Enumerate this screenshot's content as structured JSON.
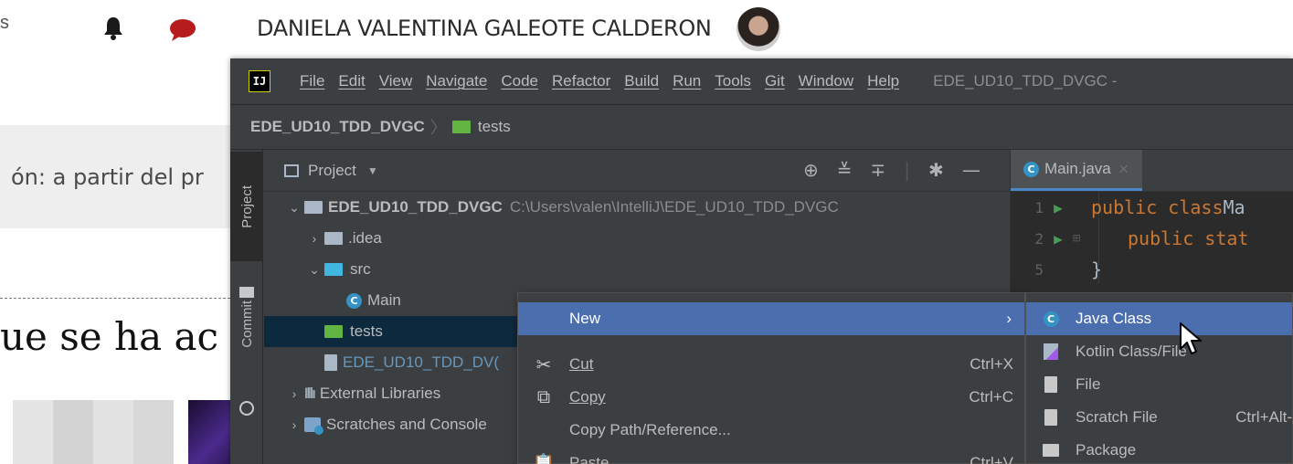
{
  "web": {
    "left_fragment": "s",
    "username": "DANIELA VALENTINA GALEOTE CALDERON",
    "gray_text": "ón: a partir del pr",
    "heading_fragment": "ue se ha ac"
  },
  "ide": {
    "menu": [
      "File",
      "Edit",
      "View",
      "Navigate",
      "Code",
      "Refactor",
      "Build",
      "Run",
      "Tools",
      "Git",
      "Window",
      "Help"
    ],
    "window_title": "EDE_UD10_TDD_DVGC -",
    "breadcrumb": {
      "root": "EDE_UD10_TDD_DVGC",
      "folder": "tests"
    },
    "side_tabs": {
      "project": "Project",
      "commit": "Commit"
    },
    "panel_title": "Project",
    "tree": {
      "root_name": "EDE_UD10_TDD_DVGC",
      "root_path": "C:\\Users\\valen\\IntelliJ\\EDE_UD10_TDD_DVGC",
      "idea": ".idea",
      "src": "src",
      "main": "Main",
      "tests": "tests",
      "iml": "EDE_UD10_TDD_DV(",
      "external_libraries": "External Libraries",
      "scratches": "Scratches and Console"
    },
    "editor": {
      "tab": "Main.java",
      "lines": [
        {
          "num": "1",
          "code_kw": "public class",
          "code_rest": " Ma"
        },
        {
          "num": "2",
          "code_kw": "public stat",
          "code_rest": ""
        },
        {
          "num": "5",
          "code_kw": "",
          "code_rest": "}"
        }
      ]
    },
    "context_menu": {
      "new": "New",
      "cut": "Cut",
      "cut_shortcut": "Ctrl+X",
      "copy": "Copy",
      "copy_shortcut": "Ctrl+C",
      "copy_path": "Copy Path/Reference...",
      "paste": "Paste",
      "paste_shortcut": "Ctrl+V"
    },
    "submenu": {
      "java_class": "Java Class",
      "kotlin": "Kotlin Class/File",
      "file": "File",
      "scratch": "Scratch File",
      "scratch_shortcut": "Ctrl+Alt-",
      "package": "Package"
    }
  },
  "colors": {
    "selection": "#4b6eaf",
    "tree_selected": "#0d293e",
    "keyword": "#cc7832",
    "folder_green": "#62b543",
    "folder_blue": "#40b6e0"
  }
}
